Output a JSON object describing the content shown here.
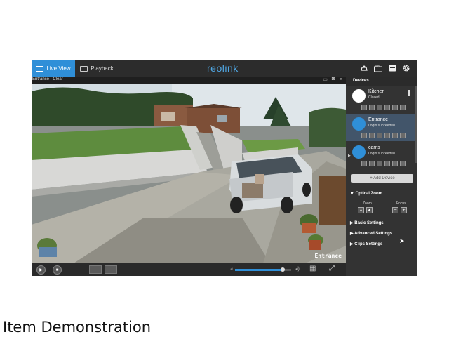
{
  "app": {
    "tabs": [
      {
        "label": "Live View",
        "icon": "monitor-icon",
        "active": true
      },
      {
        "label": "Playback",
        "icon": "film-icon",
        "active": false
      }
    ],
    "logo": "reolink",
    "top_icons": [
      "cloud-icon",
      "ram-icon",
      "device-icon",
      "gear-icon"
    ],
    "accent": "#2f8fd8"
  },
  "video": {
    "title": "Entrance - Clear",
    "stamp": "Entrance",
    "head_icons": [
      "record-icon",
      "camera-icon",
      "close-icon"
    ]
  },
  "devices": {
    "header": "Devices",
    "items": [
      {
        "name": "Kitchen",
        "status": "Closed",
        "selected": false
      },
      {
        "name": "Entrance",
        "status": "Login succeeded",
        "selected": true
      },
      {
        "name": "cams",
        "status": "Login succeeded",
        "selected": false
      }
    ],
    "add_label": "+ Add Device"
  },
  "settings": {
    "optical_zoom": "Optical Zoom",
    "zoom_label": "Zoom",
    "focus_label": "Focus",
    "basic": "Basic Settings",
    "advanced": "Advanced Settings",
    "clips": "Clips Settings"
  },
  "controls": {
    "volume": 0.85
  },
  "caption": "Item Demonstration"
}
